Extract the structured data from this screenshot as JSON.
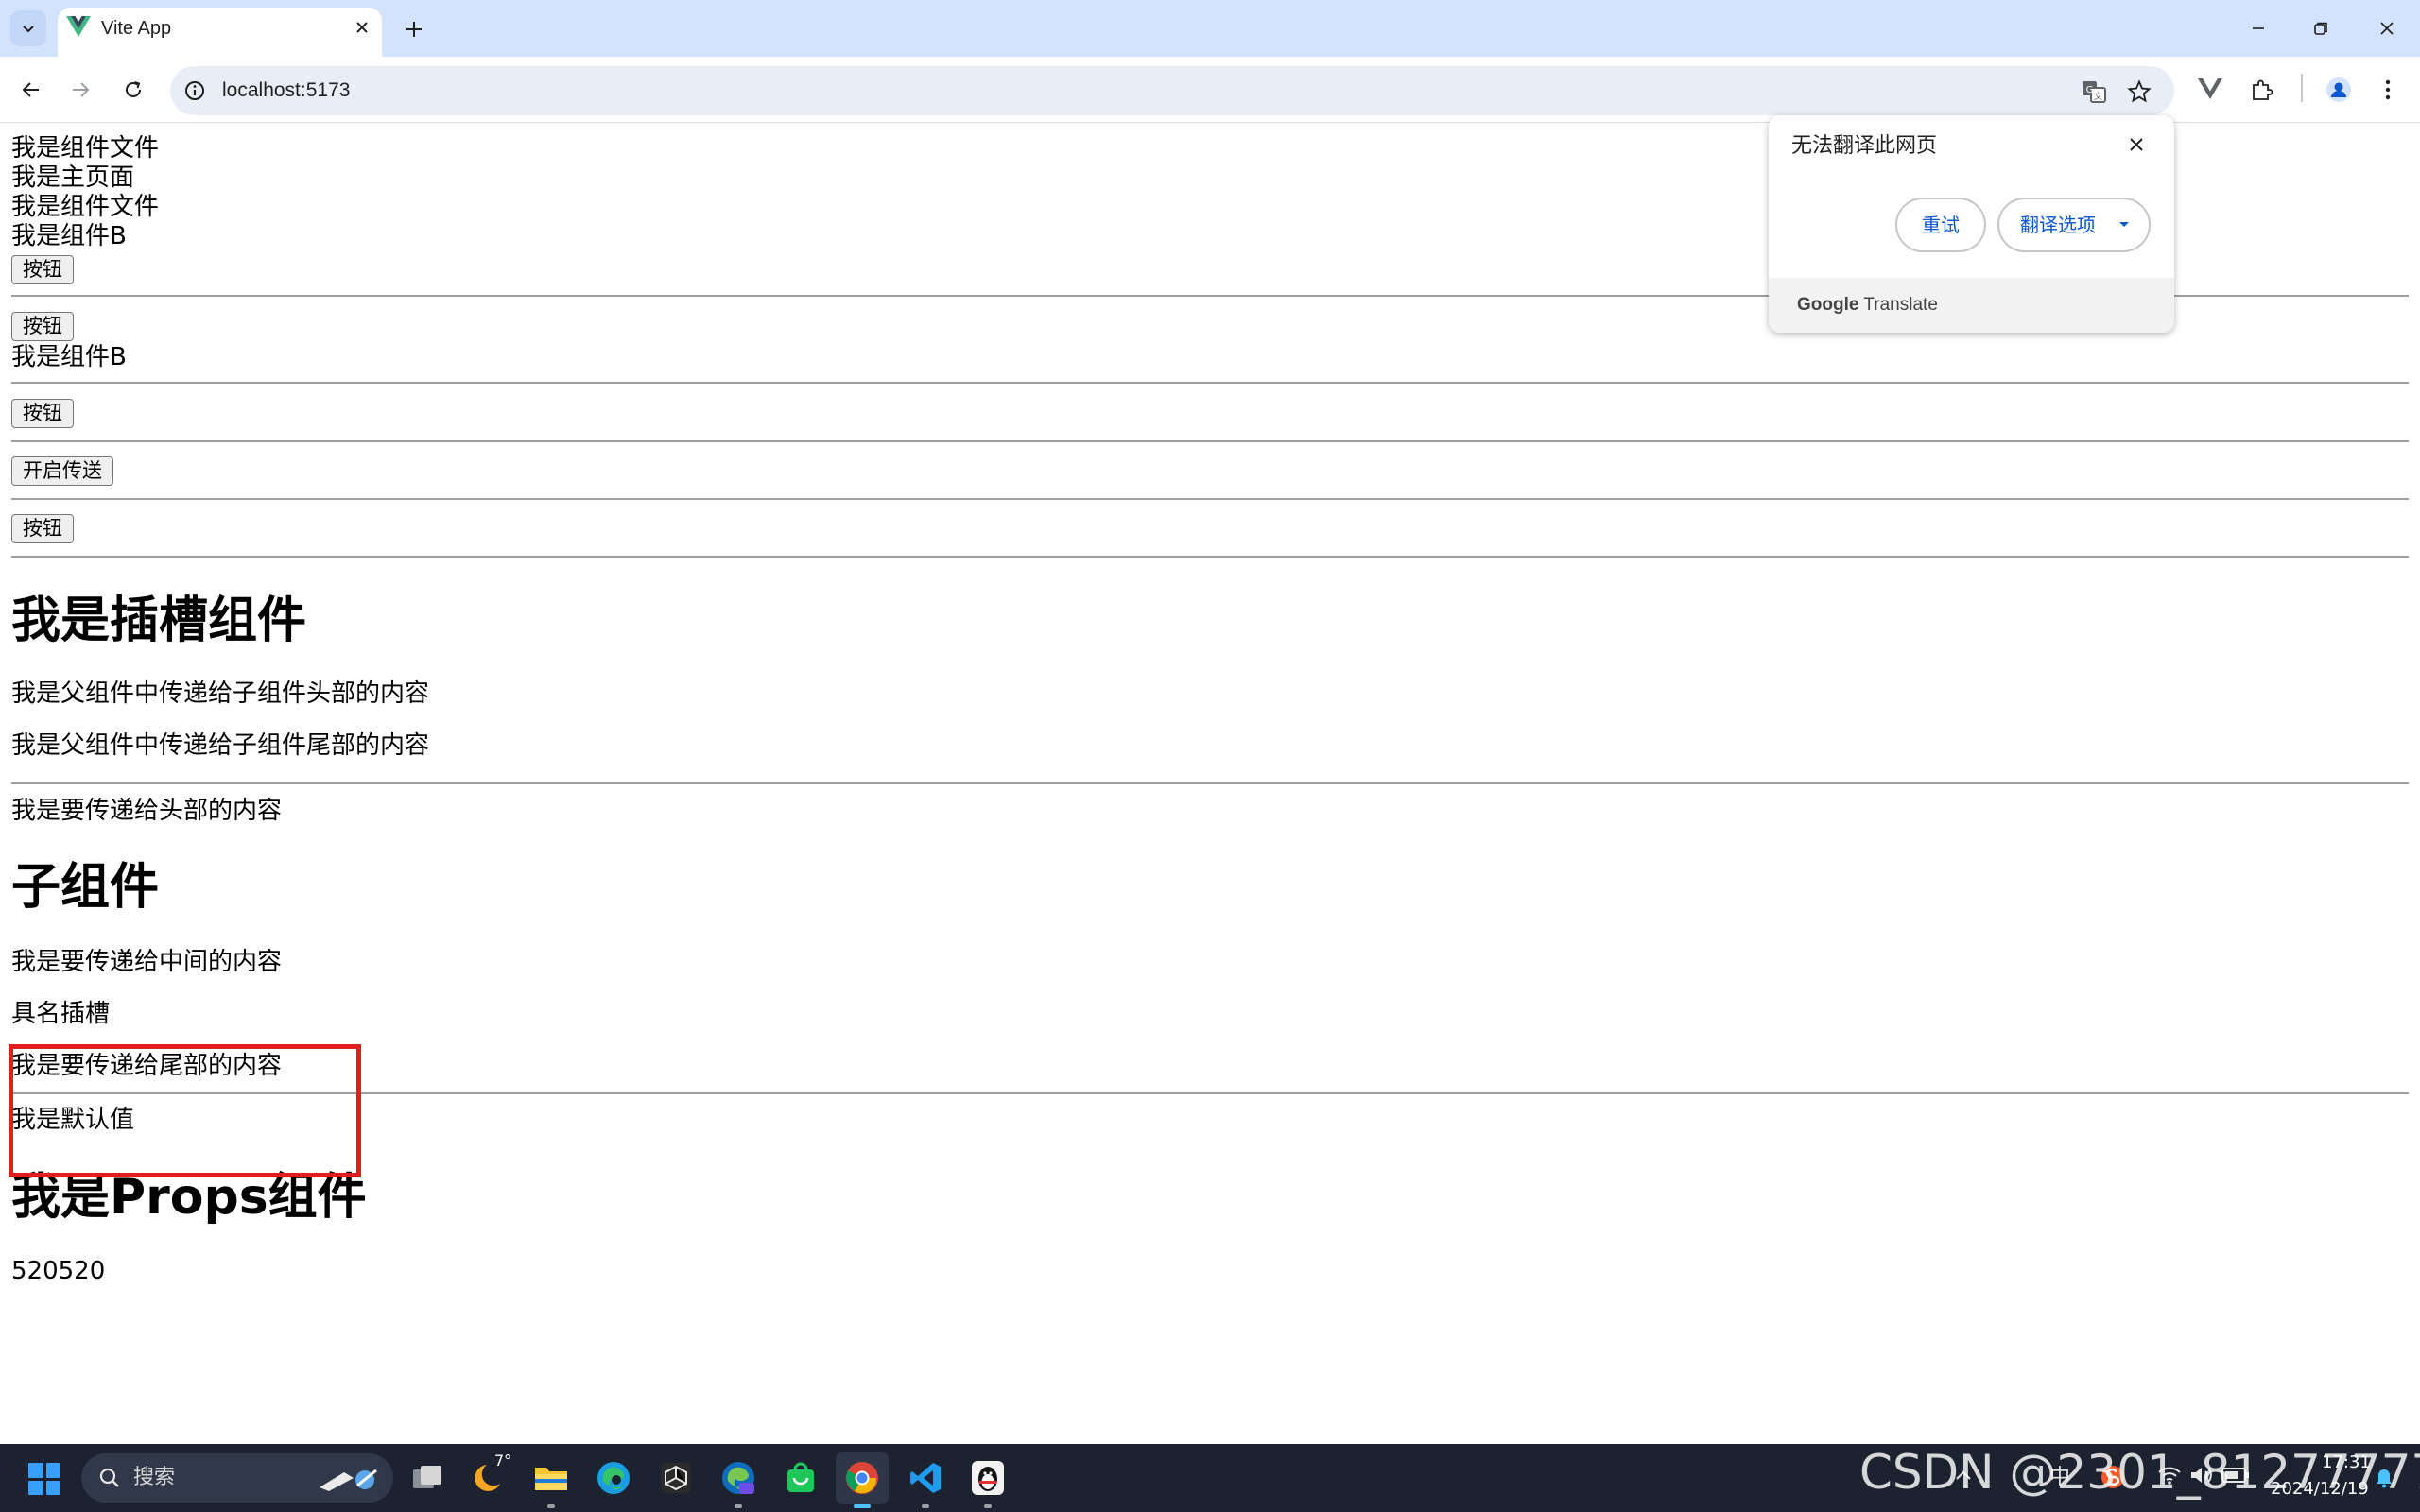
{
  "browser": {
    "tab_title": "Vite App",
    "url": "localhost:5173"
  },
  "page": {
    "line1": "我是组件文件",
    "line2": "我是主页面",
    "line3": "我是组件文件",
    "line4": "我是组件B",
    "button1": "按钮",
    "button2": "按钮",
    "line5": "我是组件B",
    "button3": "按钮",
    "send_button": "开启传送",
    "button4": "按钮",
    "slot_heading": "我是插槽组件",
    "slot_header_content": "我是父组件中传递给子组件头部的内容",
    "slot_footer_content": "我是父组件中传递给子组件尾部的内容",
    "to_header": "我是要传递给头部的内容",
    "child_heading": "子组件",
    "to_middle": "我是要传递给中间的内容",
    "named_slot": "具名插槽",
    "to_footer": "我是要传递给尾部的内容",
    "default_value": "我是默认值",
    "props_heading": "我是Props组件",
    "props_value": "520520"
  },
  "translate_popup": {
    "title": "无法翻译此网页",
    "retry": "重试",
    "options": "翻译选项",
    "footer_google": "Google",
    "footer_translate": "Translate"
  },
  "taskbar": {
    "search_label": "搜索",
    "weather": "7°",
    "time": "17:31",
    "date": "2024/12/19",
    "ime": "中"
  },
  "watermark": "CSDN @2301_81277777",
  "colors": {
    "titlebar": "#d3e3fd",
    "omnibox": "#e9eef6",
    "highlight": "#e11d1d",
    "link_blue": "#0b57d0",
    "taskbar": "#1c2230"
  }
}
